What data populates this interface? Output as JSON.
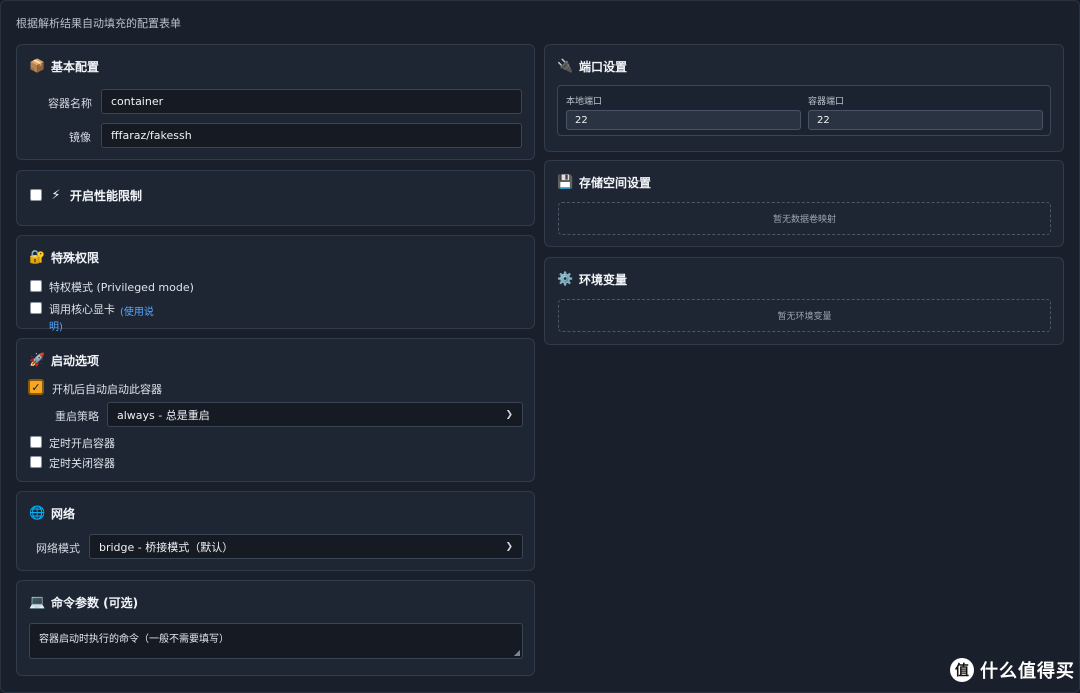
{
  "hint": "根据解析结果自动填充的配置表单",
  "basic": {
    "icon": "package-icon",
    "title": "基本配置",
    "name_label": "容器名称",
    "name_value": "container",
    "image_label": "镜像",
    "image_value": "fffaraz/fakessh"
  },
  "perf": {
    "icon": "lightning-icon",
    "title": "开启性能限制"
  },
  "privilege": {
    "icon": "lock-icon",
    "title": "特殊权限",
    "privileged_label": "特权模式 (Privileged mode)",
    "gpu_label": "调用核心显卡",
    "gpu_link_1": "(使用说",
    "gpu_link_2": "明)"
  },
  "startup": {
    "icon": "rocket-icon",
    "title": "启动选项",
    "autostart_label": "开机后自动启动此容器",
    "autostart_checked": true,
    "restart_label": "重启策略",
    "restart_value": "always - 总是重启",
    "timed_start_label": "定时开启容器",
    "timed_stop_label": "定时关闭容器"
  },
  "network": {
    "icon": "globe-icon",
    "title": "网络",
    "mode_label": "网络模式",
    "mode_value": "bridge - 桥接模式（默认）"
  },
  "command": {
    "icon": "laptop-icon",
    "title": "命令参数 (可选)",
    "placeholder": "容器启动时执行的命令（一般不需要填写）"
  },
  "ports": {
    "icon": "plug-icon",
    "title": "端口设置",
    "local_label": "本地端口",
    "local_value": "22",
    "container_label": "容器端口",
    "container_value": "22"
  },
  "storage": {
    "icon": "floppy-disk-icon",
    "title": "存储空间设置",
    "empty": "暂无数据卷映射"
  },
  "env": {
    "icon": "gear-icon",
    "title": "环境变量",
    "empty": "暂无环境变量"
  },
  "watermark": {
    "brand_logo": "值",
    "brand_text": "什么值得买"
  }
}
